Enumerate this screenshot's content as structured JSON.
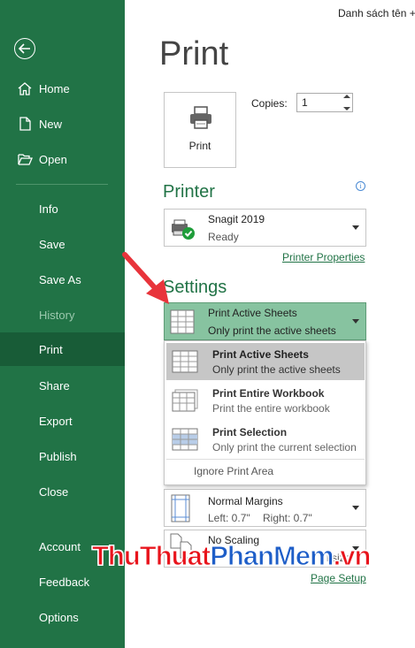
{
  "topbar": {
    "user_text": "Danh sách tên +"
  },
  "sidebar": {
    "items": [
      {
        "label": "Home",
        "icon": "home-icon"
      },
      {
        "label": "New",
        "icon": "new-document-icon"
      },
      {
        "label": "Open",
        "icon": "open-folder-icon"
      },
      {
        "label": "Info"
      },
      {
        "label": "Save"
      },
      {
        "label": "Save As"
      },
      {
        "label": "History",
        "disabled": true
      },
      {
        "label": "Print",
        "selected": true
      },
      {
        "label": "Share"
      },
      {
        "label": "Export"
      },
      {
        "label": "Publish"
      },
      {
        "label": "Close"
      },
      {
        "label": "Account"
      },
      {
        "label": "Feedback"
      },
      {
        "label": "Options"
      }
    ]
  },
  "main": {
    "title": "Print",
    "print_button_label": "Print",
    "copies": {
      "label": "Copies:",
      "value": "1"
    },
    "printer": {
      "section_title": "Printer",
      "name": "Snagit 2019",
      "status": "Ready",
      "properties_link": "Printer Properties"
    },
    "settings": {
      "section_title": "Settings",
      "selected": {
        "title": "Print Active Sheets",
        "desc": "Only print the active sheets"
      },
      "options": [
        {
          "title": "Print Active Sheets",
          "desc": "Only print the active sheets",
          "selected": true
        },
        {
          "title": "Print Entire Workbook",
          "desc": "Print the entire workbook"
        },
        {
          "title": "Print Selection",
          "desc": "Only print the current selection"
        }
      ],
      "ignore_print_area": "Ignore Print Area",
      "margins": {
        "title": "Normal Margins",
        "left": "Left:  0.7\"",
        "right": "Right:  0.7\""
      },
      "scaling": {
        "title": "No Scaling",
        "desc_visible": "l size"
      },
      "page_setup_link": "Page Setup"
    }
  },
  "watermark": {
    "part1": "ThuThuat",
    "part2": "PhanMem",
    "part3": ".vn"
  },
  "colors": {
    "sidebar": "#217346",
    "sidebar_selected": "#185c37",
    "accent": "#217346",
    "settings_highlight": "#87c3a0",
    "arrow": "#e8343b"
  }
}
